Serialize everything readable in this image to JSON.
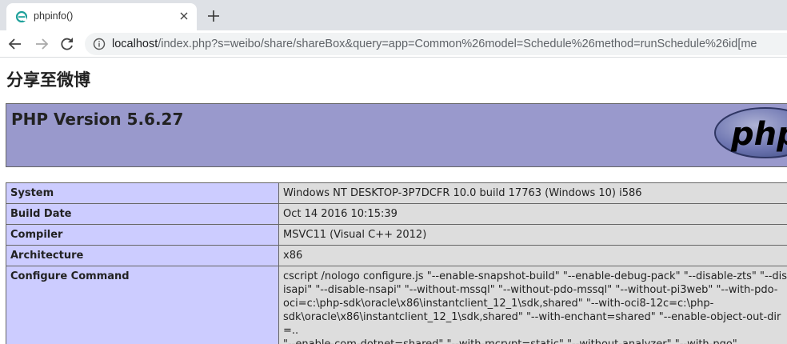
{
  "browser": {
    "tab_title": "phpinfo()",
    "url_host": "localhost",
    "url_path": "/index.php?s=weibo/share/shareBox&query=app=Common%26model=Schedule%26method=runSchedule%26id[me"
  },
  "page": {
    "heading": "分享至微博",
    "php_version": "PHP Version 5.6.27",
    "logo_text": "php"
  },
  "info_rows": [
    {
      "key": "System",
      "value": "Windows NT DESKTOP-3P7DCFR 10.0 build 17763 (Windows 10) i586"
    },
    {
      "key": "Build Date",
      "value": "Oct 14 2016 10:15:39"
    },
    {
      "key": "Compiler",
      "value": "MSVC11 (Visual C++ 2012)"
    },
    {
      "key": "Architecture",
      "value": "x86"
    },
    {
      "key": "Configure Command",
      "value": "cscript /nologo configure.js \"--enable-snapshot-build\" \"--enable-debug-pack\" \"--disable-zts\" \"--dis\nisapi\" \"--disable-nsapi\" \"--without-mssql\" \"--without-pdo-mssql\" \"--without-pi3web\" \"--with-pdo-\noci=c:\\php-sdk\\oracle\\x86\\instantclient_12_1\\sdk,shared\" \"--with-oci8-12c=c:\\php-\nsdk\\oracle\\x86\\instantclient_12_1\\sdk,shared\" \"--with-enchant=shared\" \"--enable-object-out-dir=..\n\"--enable-com-dotnet=shared\" \"--with-mcrypt=static\" \"--without-analyzer\" \"--with-pgo\""
    }
  ]
}
